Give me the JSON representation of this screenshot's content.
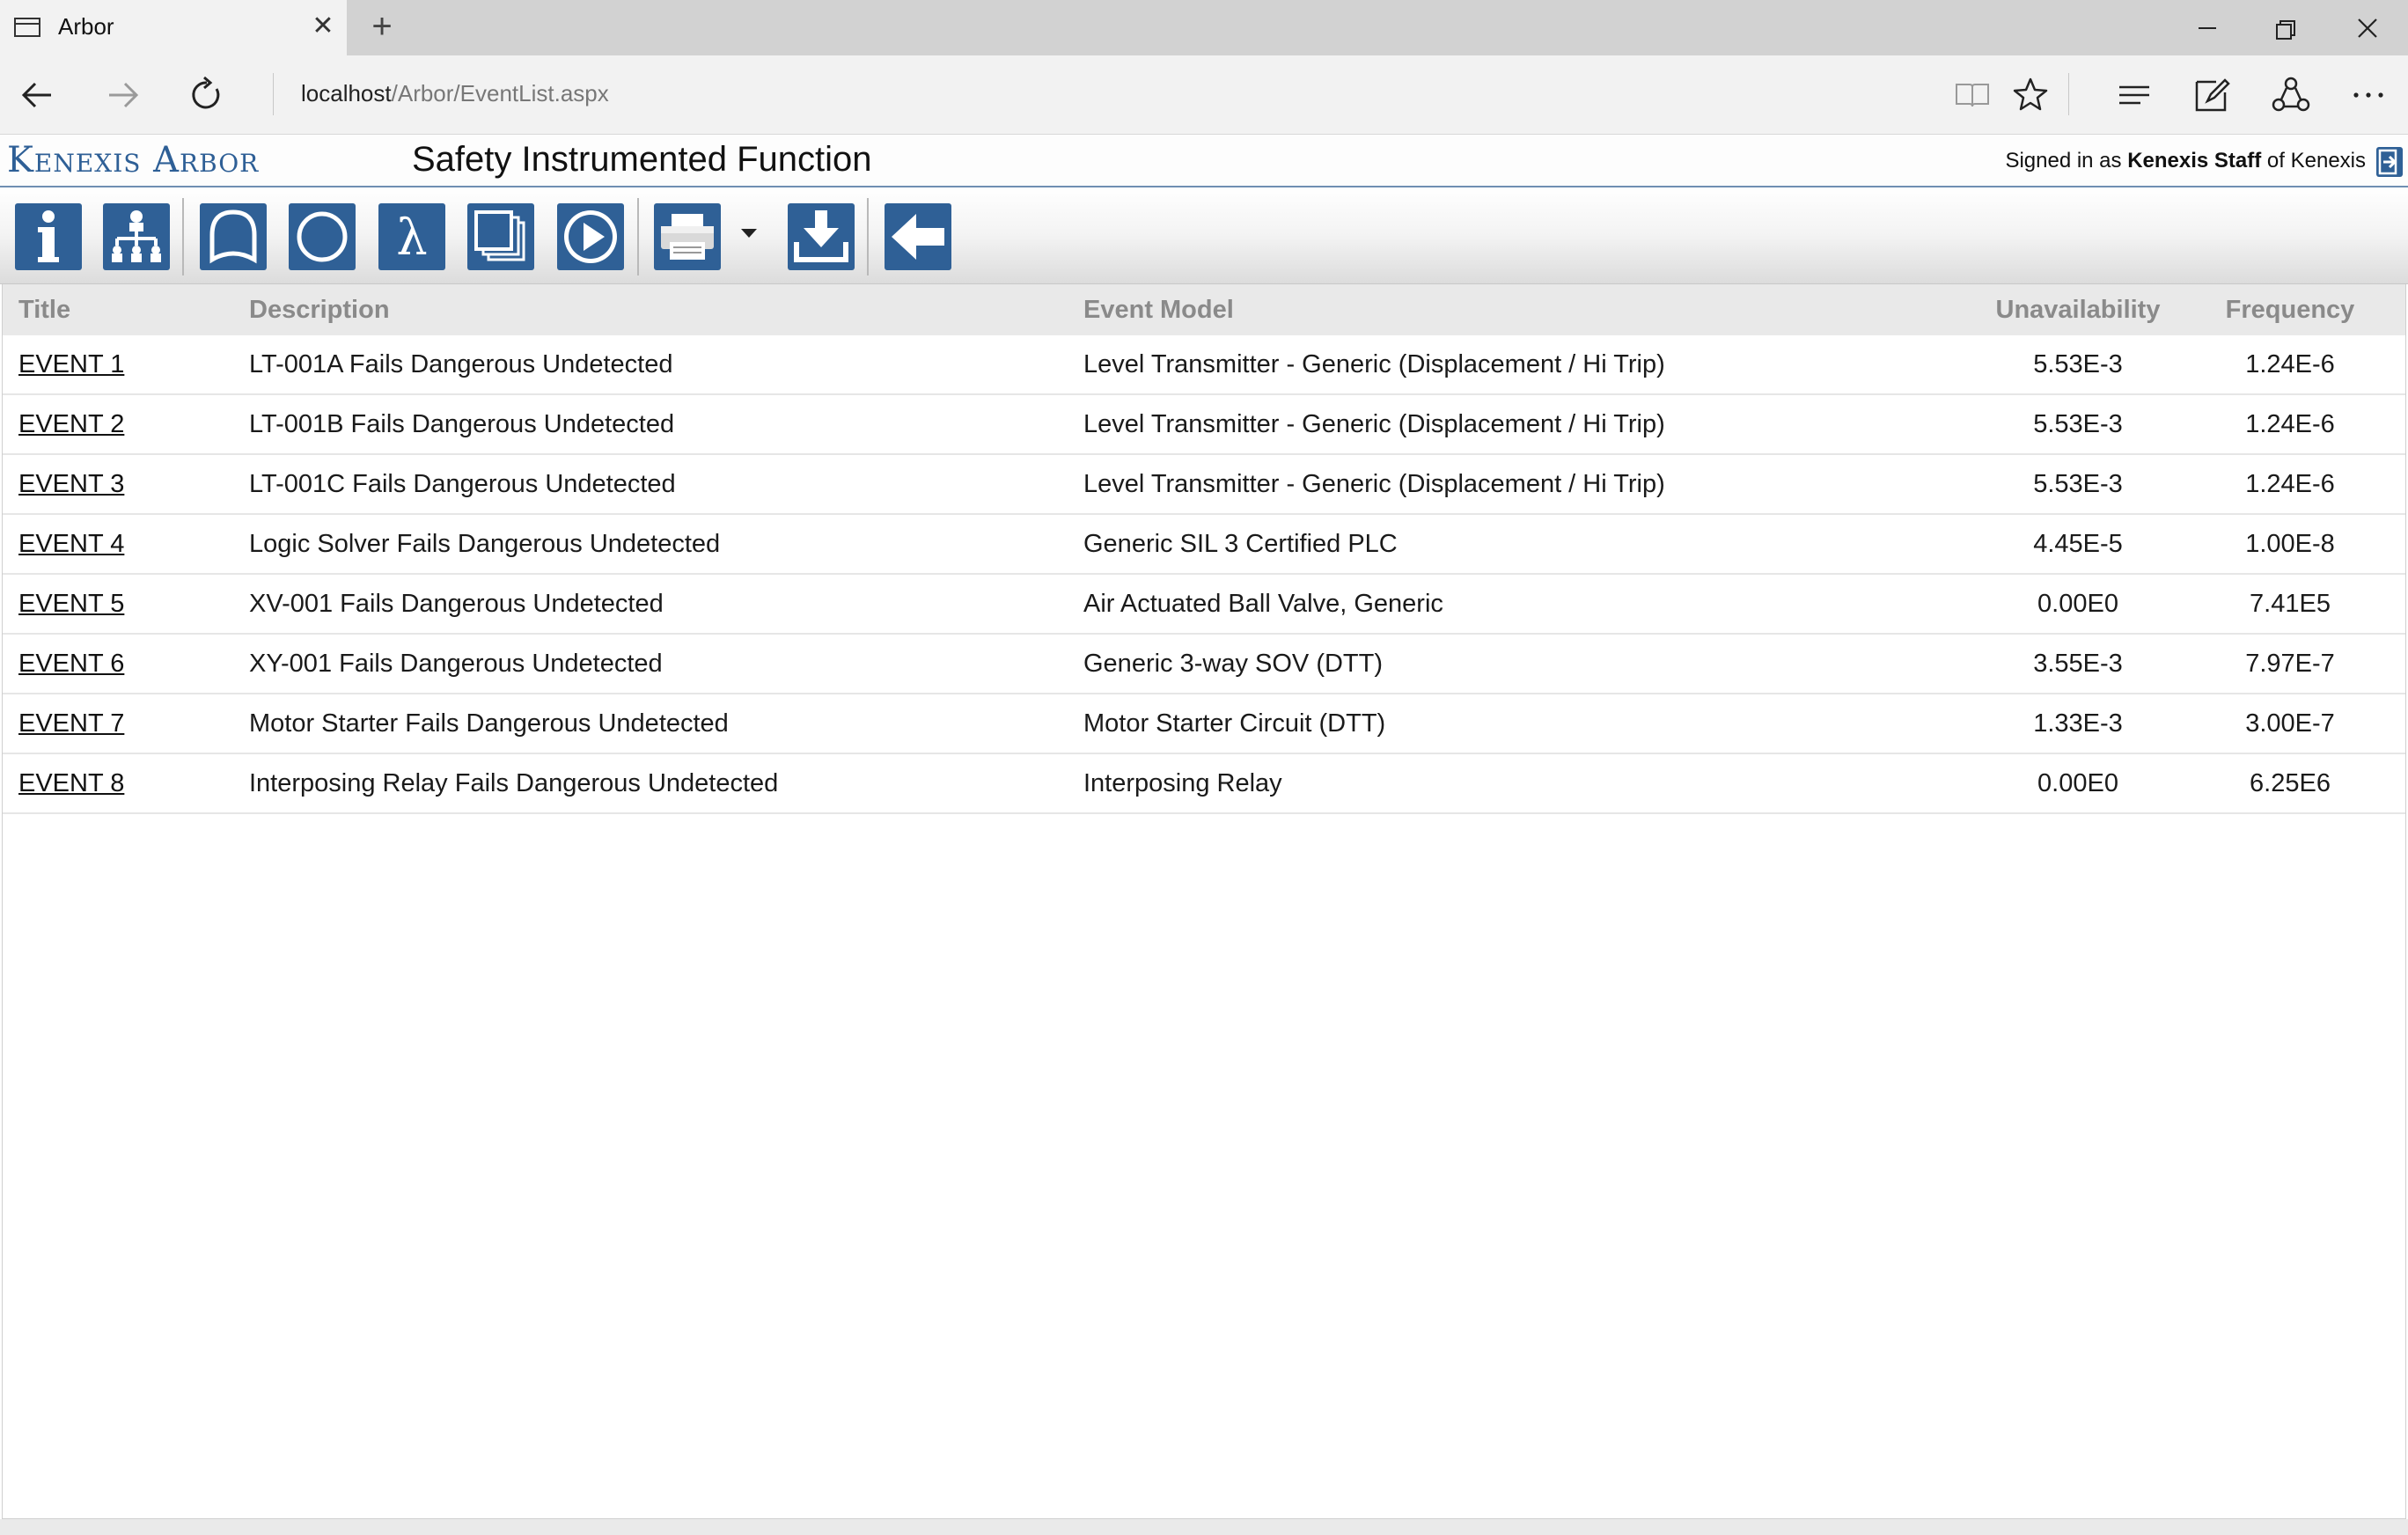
{
  "browser": {
    "tab_title": "Arbor",
    "close_glyph": "✕",
    "new_tab_glyph": "+",
    "url_host": "localhost",
    "url_path": "/Arbor/EventList.aspx"
  },
  "app": {
    "logo": "Kenexis Arbor",
    "page_title": "Safety Instrumented Function",
    "signed_in_prefix": "Signed in as ",
    "user_name": "Kenexis Staff",
    "signed_in_of": " of Kenexis",
    "brand_color": "#2f6096"
  },
  "toolbar": {
    "buttons": [
      "info-icon",
      "hierarchy-icon",
      "bowtie-icon",
      "circle-icon",
      "lambda-icon",
      "copy-pages-icon",
      "play-icon",
      "print-icon",
      "download-icon",
      "back-arrow-icon"
    ]
  },
  "table": {
    "headers": {
      "title": "Title",
      "description": "Description",
      "model": "Event Model",
      "unavailability": "Unavailability",
      "frequency": "Frequency"
    },
    "rows": [
      {
        "title": "EVENT 1",
        "description": "LT-001A Fails Dangerous Undetected",
        "model": "Level Transmitter - Generic (Displacement / Hi Trip)",
        "unavailability": "5.53E-3",
        "frequency": "1.24E-6"
      },
      {
        "title": "EVENT 2",
        "description": "LT-001B Fails Dangerous Undetected",
        "model": "Level Transmitter - Generic (Displacement / Hi Trip)",
        "unavailability": "5.53E-3",
        "frequency": "1.24E-6"
      },
      {
        "title": "EVENT 3",
        "description": "LT-001C Fails Dangerous Undetected",
        "model": "Level Transmitter - Generic (Displacement / Hi Trip)",
        "unavailability": "5.53E-3",
        "frequency": "1.24E-6"
      },
      {
        "title": "EVENT 4",
        "description": "Logic Solver Fails Dangerous Undetected",
        "model": "Generic SIL 3 Certified PLC",
        "unavailability": "4.45E-5",
        "frequency": "1.00E-8"
      },
      {
        "title": "EVENT 5",
        "description": "XV-001 Fails Dangerous Undetected",
        "model": "Air Actuated Ball Valve, Generic",
        "unavailability": "0.00E0",
        "frequency": "7.41E5"
      },
      {
        "title": "EVENT 6",
        "description": "XY-001 Fails Dangerous Undetected",
        "model": "Generic 3-way SOV (DTT)",
        "unavailability": "3.55E-3",
        "frequency": "7.97E-7"
      },
      {
        "title": "EVENT 7",
        "description": "Motor Starter Fails Dangerous Undetected",
        "model": "Motor Starter Circuit (DTT)",
        "unavailability": "1.33E-3",
        "frequency": "3.00E-7"
      },
      {
        "title": "EVENT 8",
        "description": "Interposing Relay Fails Dangerous Undetected",
        "model": "Interposing Relay",
        "unavailability": "0.00E0",
        "frequency": "6.25E6"
      }
    ]
  }
}
